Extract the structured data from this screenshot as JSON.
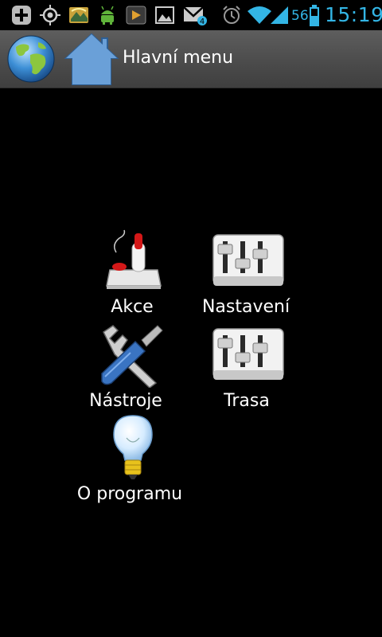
{
  "status_bar": {
    "icons": [
      "add-icon",
      "gps-icon",
      "app-icon",
      "android-icon",
      "media-icon",
      "gallery-icon",
      "gmail-icon",
      "alarm-icon",
      "wifi-icon",
      "signal-icon",
      "battery-icon"
    ],
    "gmail_badge": "4",
    "battery_percent": "56",
    "time": "15:19",
    "accent_color": "#33b5e5"
  },
  "action_bar": {
    "title": "Hlavní menu"
  },
  "menu": {
    "items": [
      {
        "label": "Akce",
        "icon": "joystick-icon"
      },
      {
        "label": "Nastavení",
        "icon": "mixer-icon"
      },
      {
        "label": "Nástroje",
        "icon": "tools-icon"
      },
      {
        "label": "Trasa",
        "icon": "mixer-icon"
      },
      {
        "label": "O programu",
        "icon": "lightbulb-icon"
      }
    ]
  }
}
